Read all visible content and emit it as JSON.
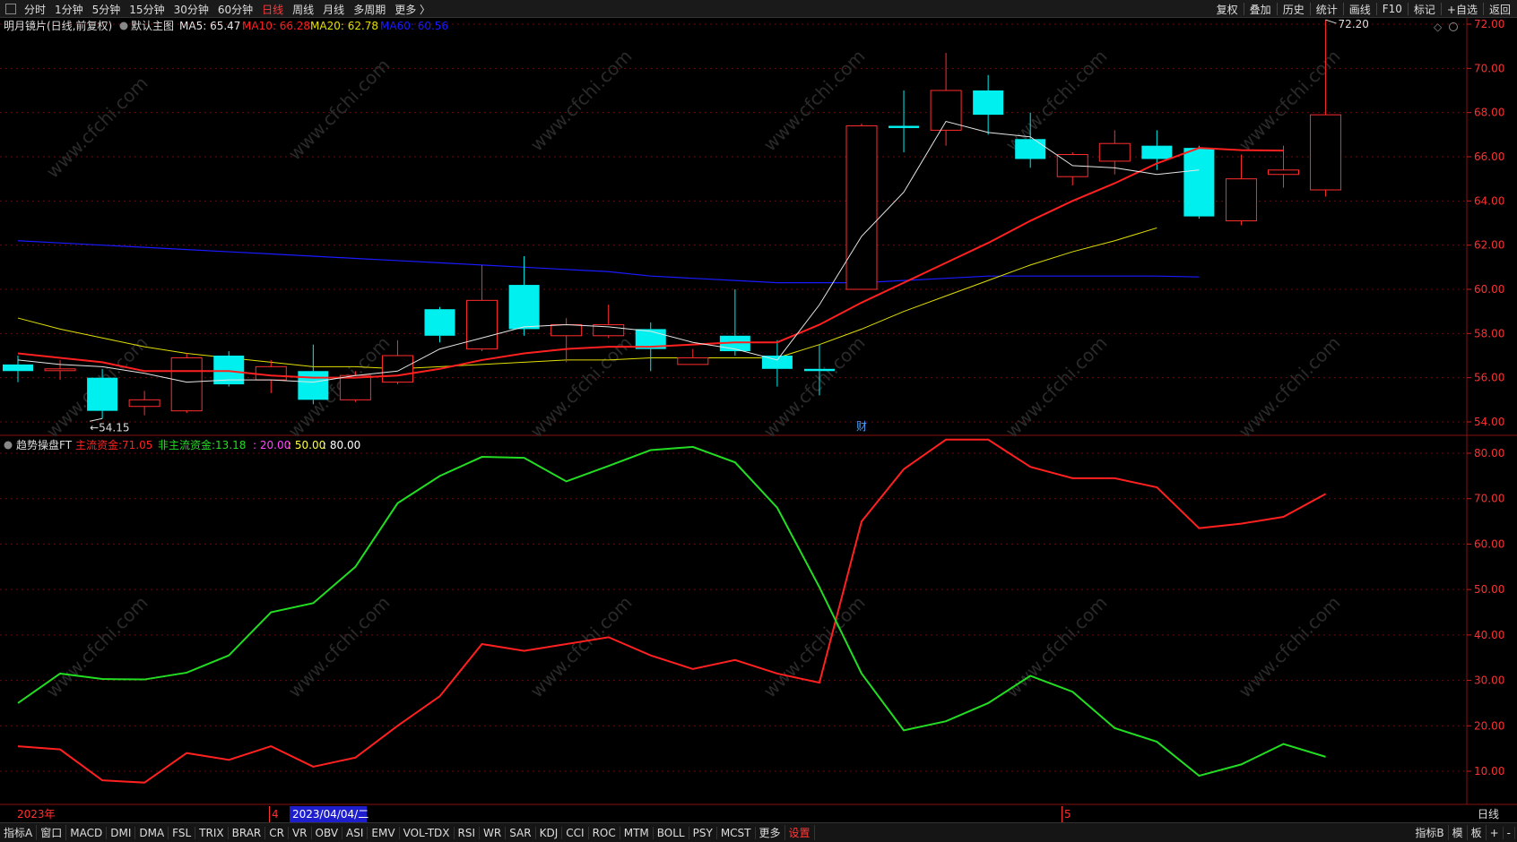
{
  "topbar": {
    "periods": [
      "分时",
      "1分钟",
      "5分钟",
      "15分钟",
      "30分钟",
      "60分钟",
      "日线",
      "周线",
      "月线",
      "多周期",
      "更多 〉"
    ],
    "active_period": "日线",
    "right_buttons": [
      "复权",
      "叠加",
      "历史",
      "统计",
      "画线",
      "F10",
      "标记",
      "+自选",
      "返回"
    ]
  },
  "bottombar": {
    "indicators": [
      "指标A",
      "窗口",
      "MACD",
      "DMI",
      "DMA",
      "FSL",
      "TRIX",
      "BRAR",
      "CR",
      "VR",
      "OBV",
      "ASI",
      "EMV",
      "VOL-TDX",
      "RSI",
      "WR",
      "SAR",
      "KDJ",
      "CCI",
      "ROC",
      "MTM",
      "BOLL",
      "PSY",
      "MCST",
      "更多",
      "设置"
    ],
    "right_items": [
      "指标B",
      "模",
      "板",
      "+",
      "-"
    ]
  },
  "watermark": "www.cfchi.com",
  "colors": {
    "up": "#ff2d2d",
    "down": "#00f0f0",
    "ma5": "#e6e6e6",
    "ma10": "#ff2020",
    "ma20": "#e0e000",
    "ma60": "#1a1aff",
    "main_fund": "#ff2020",
    "nonmain_fund": "#22dd22"
  },
  "chart_data": [
    {
      "type": "candlestick",
      "legend_title": "明月镜片(日线,前复权)",
      "main_chart_label": "默认主图",
      "ma": [
        {
          "name": "MA5",
          "value": "65.47",
          "values": [
            56.8,
            56.6,
            56.5,
            56.2,
            55.8,
            55.9,
            55.9,
            55.8,
            56.1,
            56.3,
            57.3,
            57.8,
            58.3,
            58.4,
            58.3,
            58.1,
            57.6,
            57.3,
            56.8,
            59.3,
            62.4,
            64.4,
            67.6,
            67.1,
            66.9,
            65.6,
            65.5,
            65.2,
            65.4
          ]
        },
        {
          "name": "MA10",
          "value": "66.28",
          "values": [
            57.1,
            56.9,
            56.7,
            56.3,
            56.3,
            56.3,
            56.1,
            56.0,
            56.0,
            56.1,
            56.4,
            56.8,
            57.1,
            57.3,
            57.4,
            57.4,
            57.5,
            57.6,
            57.6,
            58.4,
            59.4,
            60.3,
            61.2,
            62.1,
            63.1,
            64.0,
            64.8,
            65.7,
            66.4,
            66.3,
            66.28
          ]
        },
        {
          "name": "MA20",
          "value": "62.78",
          "values": [
            58.7,
            58.2,
            57.8,
            57.4,
            57.1,
            56.9,
            56.7,
            56.5,
            56.5,
            56.4,
            56.5,
            56.6,
            56.7,
            56.8,
            56.8,
            56.9,
            56.9,
            56.9,
            56.9,
            57.5,
            58.2,
            59.0,
            59.7,
            60.4,
            61.1,
            61.7,
            62.2,
            62.78
          ]
        },
        {
          "name": "MA60",
          "value": "60.56",
          "values": [
            62.2,
            62.1,
            62.0,
            61.9,
            61.8,
            61.7,
            61.6,
            61.5,
            61.4,
            61.3,
            61.2,
            61.1,
            61.0,
            60.9,
            60.8,
            60.6,
            60.5,
            60.4,
            60.3,
            60.3,
            60.3,
            60.4,
            60.5,
            60.6,
            60.6,
            60.6,
            60.6,
            60.6,
            60.56
          ]
        }
      ],
      "candles": [
        {
          "o": 56.6,
          "h": 57.0,
          "l": 55.8,
          "c": 56.3
        },
        {
          "o": 56.4,
          "h": 56.8,
          "l": 55.9,
          "c": 56.4
        },
        {
          "o": 56.0,
          "h": 56.4,
          "l": 54.15,
          "c": 54.5
        },
        {
          "o": 54.7,
          "h": 55.4,
          "l": 54.3,
          "c": 55.0
        },
        {
          "o": 54.5,
          "h": 57.1,
          "l": 54.4,
          "c": 56.9
        },
        {
          "o": 57.0,
          "h": 57.2,
          "l": 55.6,
          "c": 55.7
        },
        {
          "o": 55.9,
          "h": 56.8,
          "l": 55.3,
          "c": 56.5
        },
        {
          "o": 56.3,
          "h": 57.5,
          "l": 54.8,
          "c": 55.0
        },
        {
          "o": 55.0,
          "h": 56.3,
          "l": 54.9,
          "c": 56.1
        },
        {
          "o": 55.8,
          "h": 57.7,
          "l": 55.7,
          "c": 57.0
        },
        {
          "o": 59.1,
          "h": 59.2,
          "l": 57.6,
          "c": 57.9
        },
        {
          "o": 57.3,
          "h": 61.1,
          "l": 57.2,
          "c": 59.5
        },
        {
          "o": 60.2,
          "h": 61.5,
          "l": 57.9,
          "c": 58.2
        },
        {
          "o": 57.9,
          "h": 58.7,
          "l": 56.7,
          "c": 58.4
        },
        {
          "o": 57.9,
          "h": 59.3,
          "l": 57.8,
          "c": 58.4
        },
        {
          "o": 58.2,
          "h": 58.5,
          "l": 56.3,
          "c": 57.3
        },
        {
          "o": 56.6,
          "h": 57.3,
          "l": 56.6,
          "c": 56.9
        },
        {
          "o": 57.9,
          "h": 60.0,
          "l": 57.0,
          "c": 57.2
        },
        {
          "o": 57.0,
          "h": 57.7,
          "l": 55.6,
          "c": 56.4
        },
        {
          "o": 56.4,
          "h": 57.5,
          "l": 55.2,
          "c": 56.3
        },
        {
          "o": 60.0,
          "h": 67.5,
          "l": 60.0,
          "c": 67.4
        },
        {
          "o": 67.4,
          "h": 69.0,
          "l": 66.2,
          "c": 67.3
        },
        {
          "o": 67.2,
          "h": 70.7,
          "l": 66.5,
          "c": 69.0
        },
        {
          "o": 69.0,
          "h": 69.7,
          "l": 67.0,
          "c": 67.9
        },
        {
          "o": 66.8,
          "h": 68.0,
          "l": 65.5,
          "c": 65.9
        },
        {
          "o": 65.1,
          "h": 66.2,
          "l": 64.7,
          "c": 66.1
        },
        {
          "o": 65.8,
          "h": 67.2,
          "l": 65.2,
          "c": 66.6
        },
        {
          "o": 66.5,
          "h": 67.2,
          "l": 65.4,
          "c": 65.9
        },
        {
          "o": 66.4,
          "h": 66.5,
          "l": 63.2,
          "c": 63.3
        },
        {
          "o": 63.1,
          "h": 66.1,
          "l": 62.9,
          "c": 65.0
        },
        {
          "o": 65.2,
          "h": 66.5,
          "l": 64.6,
          "c": 65.4
        },
        {
          "o": 64.5,
          "h": 72.2,
          "l": 64.2,
          "c": 67.9
        }
      ],
      "ylim": [
        53.4,
        73.0
      ],
      "yticks": [
        "72.00",
        "70.00",
        "68.00",
        "66.00",
        "64.00",
        "62.00",
        "60.00",
        "58.00",
        "56.00",
        "54.00"
      ],
      "annotations": {
        "high": "72.20",
        "low": "54.15",
        "event": "财"
      }
    },
    {
      "type": "line",
      "legend_title": "趋势操盘FT",
      "legend": [
        {
          "label": "主流资金:",
          "value": "71.05"
        },
        {
          "label": "非主流资金:",
          "value": "13.18"
        },
        {
          "label": "",
          "value": ": 20.00"
        },
        {
          "label": "",
          "value": ": 50.00"
        },
        {
          "label": "",
          "value": ": 80.00"
        }
      ],
      "series": [
        {
          "name": "主流资金",
          "values": [
            15.5,
            14.8,
            8.0,
            7.5,
            14.0,
            12.5,
            15.5,
            11.0,
            13.0,
            20.0,
            26.5,
            38.0,
            36.5,
            38.0,
            39.5,
            35.5,
            32.5,
            34.5,
            31.5,
            29.5,
            65.0,
            76.5,
            83.0,
            83.0,
            77.0,
            74.5,
            74.5,
            72.5,
            63.5,
            64.5,
            66.0,
            71.05
          ]
        },
        {
          "name": "非主流资金",
          "values": [
            25.0,
            31.5,
            30.3,
            30.2,
            31.7,
            35.5,
            45.0,
            47.0,
            55.0,
            69.0,
            75.0,
            79.2,
            79.0,
            73.8,
            77.2,
            80.7,
            81.4,
            78.0,
            68.0,
            50.5,
            31.5,
            19.0,
            21.0,
            25.0,
            31.0,
            27.5,
            19.5,
            16.5,
            9.0,
            11.5,
            16.0,
            13.18
          ]
        }
      ],
      "ylim": [
        8.0,
        84.5
      ],
      "yticks": [
        "80.00",
        "70.00",
        "60.00",
        "50.00",
        "40.00",
        "30.00",
        "20.00",
        "10.00"
      ],
      "reference_lines": [
        20,
        50,
        80
      ]
    }
  ],
  "xaxis": {
    "labels": [
      "2023年",
      "4",
      "2023/04/04/二",
      "5"
    ],
    "period_label": "日线"
  }
}
